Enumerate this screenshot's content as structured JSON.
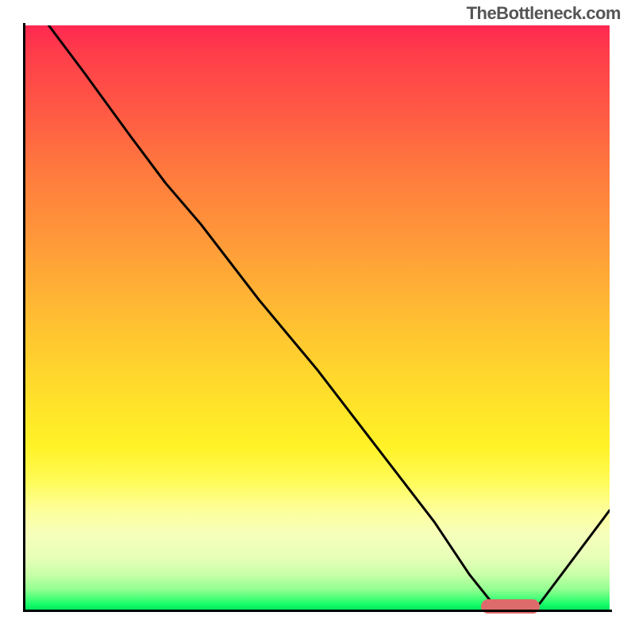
{
  "watermark": "TheBottleneck.com",
  "chart_data": {
    "type": "line",
    "title": "",
    "xlabel": "",
    "ylabel": "",
    "xlim": [
      0,
      100
    ],
    "ylim": [
      0,
      100
    ],
    "grid": false,
    "legend": false,
    "annotations": [],
    "gradient_bands": [
      {
        "color": "#ff2850",
        "stop": 0
      },
      {
        "color": "#ffcb2f",
        "stop": 55
      },
      {
        "color": "#fff226",
        "stop": 72
      },
      {
        "color": "#f6ffba",
        "stop": 87
      },
      {
        "color": "#00e860",
        "stop": 100
      }
    ],
    "series": [
      {
        "name": "curve",
        "x": [
          4,
          10,
          18,
          24,
          30,
          40,
          50,
          60,
          70,
          76,
          80,
          84,
          88,
          100
        ],
        "y": [
          100,
          92,
          81,
          73,
          66,
          53,
          41,
          28,
          15,
          6,
          1,
          0,
          1,
          17
        ]
      }
    ],
    "marker": {
      "x_start": 78,
      "x_end": 88,
      "y": 0.5
    }
  }
}
